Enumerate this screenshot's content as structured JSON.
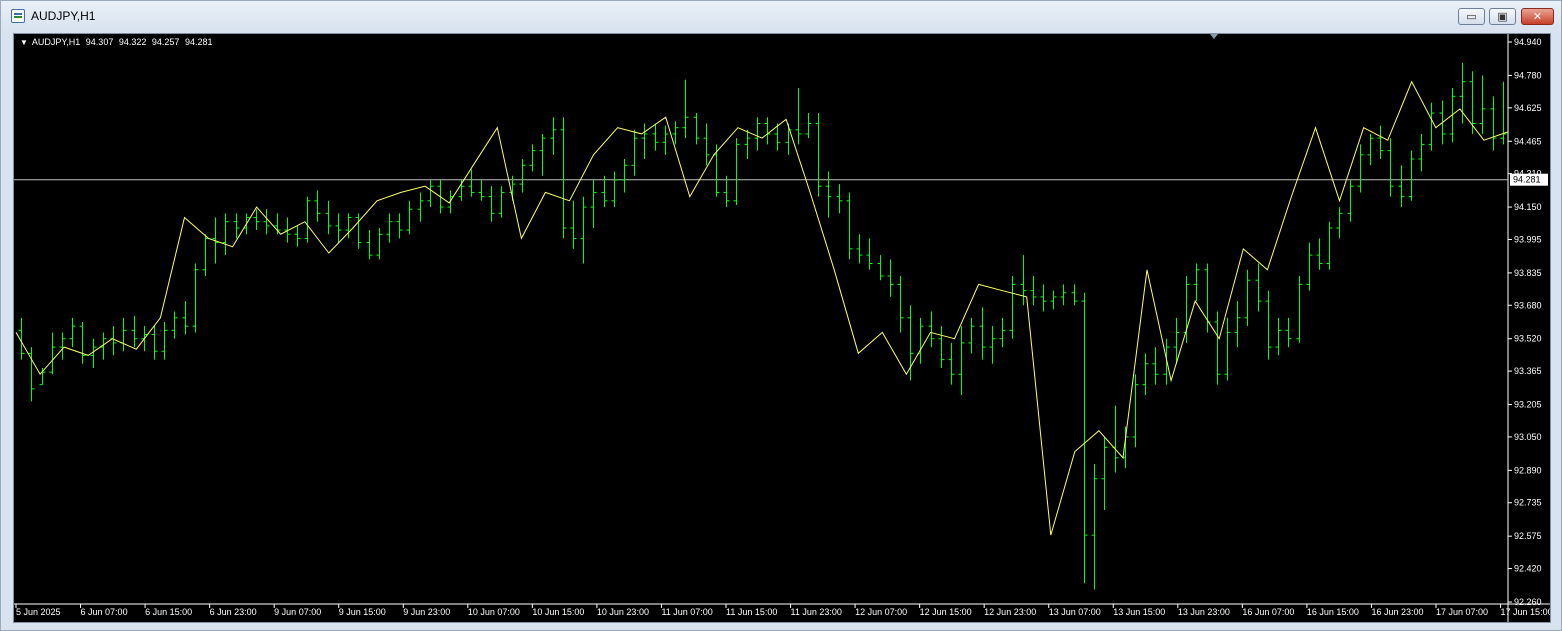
{
  "window": {
    "title": "AUDJPY,H1"
  },
  "buttons": {
    "minimize": "▭",
    "maximize": "▣",
    "close": "✕"
  },
  "header": {
    "symbol": "AUDJPY,H1",
    "open": "94.307",
    "high": "94.322",
    "low": "94.257",
    "close": "94.281"
  },
  "colors": {
    "background": "#000000",
    "bars": "#00ff00",
    "zigzag": "#ffff66",
    "price_line": "#c0c0c0",
    "axis_text": "#ffffff"
  },
  "chart_data": {
    "type": "ohlc",
    "symbol": "AUDJPY",
    "timeframe": "H1",
    "current_price": 94.281,
    "ylim": [
      92.26,
      94.94
    ],
    "yticks": [
      "94.940",
      "94.780",
      "94.625",
      "94.465",
      "94.310",
      "94.150",
      "93.995",
      "93.835",
      "93.680",
      "93.520",
      "93.365",
      "93.205",
      "93.050",
      "92.890",
      "92.735",
      "92.575",
      "92.420",
      "92.260"
    ],
    "current_price_label": "94.281",
    "xticks": [
      "5 Jun 2025",
      "6 Jun 07:00",
      "6 Jun 15:00",
      "6 Jun 23:00",
      "9 Jun 07:00",
      "9 Jun 15:00",
      "9 Jun 23:00",
      "10 Jun 07:00",
      "10 Jun 15:00",
      "10 Jun 23:00",
      "11 Jun 07:00",
      "11 Jun 15:00",
      "11 Jun 23:00",
      "12 Jun 07:00",
      "12 Jun 15:00",
      "12 Jun 23:00",
      "13 Jun 07:00",
      "13 Jun 15:00",
      "13 Jun 23:00",
      "16 Jun 07:00",
      "16 Jun 15:00",
      "16 Jun 23:00",
      "17 Jun 07:00",
      "17 Jun 15:00"
    ],
    "zigzag": [
      93.55,
      93.35,
      93.48,
      93.44,
      93.52,
      93.47,
      93.62,
      94.1,
      94.0,
      93.96,
      94.15,
      94.02,
      94.08,
      93.93,
      94.05,
      94.18,
      94.22,
      94.25,
      94.17,
      94.35,
      94.53,
      94.0,
      94.22,
      94.18,
      94.4,
      94.53,
      94.5,
      94.58,
      94.2,
      94.4,
      94.53,
      94.48,
      94.57,
      94.22,
      93.85,
      93.45,
      93.55,
      93.35,
      93.55,
      93.52,
      93.78,
      93.75,
      93.72,
      92.58,
      92.98,
      93.08,
      92.95,
      93.85,
      93.32,
      93.7,
      93.52,
      93.95,
      93.85,
      94.2,
      94.53,
      94.18,
      94.53,
      94.47,
      94.75,
      94.53,
      94.62,
      94.47,
      94.51
    ],
    "bars": [
      [
        93.56,
        93.62,
        93.42,
        93.45
      ],
      [
        93.45,
        93.48,
        93.22,
        93.28
      ],
      [
        93.3,
        93.38,
        93.3,
        93.36
      ],
      [
        93.36,
        93.55,
        93.35,
        93.48
      ],
      [
        93.48,
        93.55,
        93.42,
        93.52
      ],
      [
        93.52,
        93.62,
        93.48,
        93.58
      ],
      [
        93.58,
        93.6,
        93.4,
        93.44
      ],
      [
        93.44,
        93.52,
        93.38,
        93.48
      ],
      [
        93.48,
        93.55,
        93.42,
        93.52
      ],
      [
        93.52,
        93.58,
        93.44,
        93.5
      ],
      [
        93.5,
        93.62,
        93.46,
        93.56
      ],
      [
        93.56,
        93.63,
        93.48,
        93.52
      ],
      [
        93.52,
        93.58,
        93.46,
        93.54
      ],
      [
        93.54,
        93.58,
        93.42,
        93.46
      ],
      [
        93.46,
        93.6,
        93.42,
        93.56
      ],
      [
        93.56,
        93.65,
        93.52,
        93.62
      ],
      [
        93.62,
        93.7,
        93.54,
        93.58
      ],
      [
        93.58,
        93.88,
        93.55,
        93.85
      ],
      [
        93.85,
        94.02,
        93.82,
        94.0
      ],
      [
        94.0,
        94.1,
        93.88,
        93.98
      ],
      [
        93.98,
        94.12,
        93.92,
        94.08
      ],
      [
        94.08,
        94.12,
        94.0,
        94.05
      ],
      [
        94.05,
        94.12,
        94.02,
        94.1
      ],
      [
        94.1,
        94.14,
        94.04,
        94.08
      ],
      [
        94.08,
        94.14,
        94.02,
        94.06
      ],
      [
        94.06,
        94.12,
        94.02,
        94.04
      ],
      [
        94.04,
        94.1,
        93.98,
        94.02
      ],
      [
        94.02,
        94.06,
        93.96,
        94.0
      ],
      [
        94.0,
        94.2,
        93.98,
        94.18
      ],
      [
        94.18,
        94.23,
        94.08,
        94.12
      ],
      [
        94.12,
        94.18,
        94.02,
        94.06
      ],
      [
        94.06,
        94.12,
        93.98,
        94.04
      ],
      [
        94.04,
        94.12,
        94.0,
        94.1
      ],
      [
        94.1,
        94.12,
        93.95,
        93.98
      ],
      [
        93.98,
        94.04,
        93.9,
        93.92
      ],
      [
        93.92,
        94.05,
        93.9,
        94.02
      ],
      [
        94.02,
        94.12,
        93.98,
        94.08
      ],
      [
        94.08,
        94.12,
        94.0,
        94.04
      ],
      [
        94.04,
        94.18,
        94.02,
        94.14
      ],
      [
        94.14,
        94.22,
        94.08,
        94.18
      ],
      [
        94.18,
        94.28,
        94.15,
        94.25
      ],
      [
        94.25,
        94.28,
        94.12,
        94.15
      ],
      [
        94.15,
        94.23,
        94.12,
        94.2
      ],
      [
        94.2,
        94.28,
        94.18,
        94.25
      ],
      [
        94.25,
        94.33,
        94.2,
        94.22
      ],
      [
        94.22,
        94.28,
        94.18,
        94.2
      ],
      [
        94.2,
        94.25,
        94.08,
        94.12
      ],
      [
        94.12,
        94.25,
        94.1,
        94.22
      ],
      [
        94.22,
        94.3,
        94.18,
        94.26
      ],
      [
        94.26,
        94.38,
        94.22,
        94.35
      ],
      [
        94.35,
        94.45,
        94.32,
        94.42
      ],
      [
        94.42,
        94.5,
        94.3,
        94.48
      ],
      [
        94.48,
        94.58,
        94.4,
        94.52
      ],
      [
        94.52,
        94.58,
        94.0,
        94.05
      ],
      [
        94.05,
        94.18,
        93.95,
        94.0
      ],
      [
        94.0,
        94.2,
        93.88,
        94.15
      ],
      [
        94.15,
        94.28,
        94.05,
        94.22
      ],
      [
        94.22,
        94.3,
        94.15,
        94.18
      ],
      [
        94.18,
        94.32,
        94.15,
        94.28
      ],
      [
        94.28,
        94.38,
        94.22,
        94.35
      ],
      [
        94.35,
        94.52,
        94.3,
        94.48
      ],
      [
        94.48,
        94.55,
        94.38,
        94.5
      ],
      [
        94.5,
        94.55,
        94.42,
        94.46
      ],
      [
        94.46,
        94.54,
        94.4,
        94.5
      ],
      [
        94.5,
        94.56,
        94.45,
        94.53
      ],
      [
        94.53,
        94.76,
        94.48,
        94.58
      ],
      [
        94.58,
        94.6,
        94.45,
        94.48
      ],
      [
        94.48,
        94.55,
        94.35,
        94.4
      ],
      [
        94.4,
        94.45,
        94.2,
        94.22
      ],
      [
        94.22,
        94.3,
        94.15,
        94.18
      ],
      [
        94.18,
        94.48,
        94.16,
        94.45
      ],
      [
        94.45,
        94.52,
        94.38,
        94.48
      ],
      [
        94.48,
        94.58,
        94.42,
        94.55
      ],
      [
        94.55,
        94.58,
        94.45,
        94.5
      ],
      [
        94.5,
        94.55,
        94.42,
        94.46
      ],
      [
        94.46,
        94.55,
        94.4,
        94.52
      ],
      [
        94.52,
        94.72,
        94.45,
        94.5
      ],
      [
        94.5,
        94.6,
        94.48,
        94.55
      ],
      [
        94.55,
        94.6,
        94.2,
        94.25
      ],
      [
        94.25,
        94.32,
        94.1,
        94.2
      ],
      [
        94.2,
        94.26,
        94.12,
        94.18
      ],
      [
        94.18,
        94.22,
        93.9,
        93.95
      ],
      [
        93.95,
        94.02,
        93.88,
        93.92
      ],
      [
        93.92,
        94.0,
        93.85,
        93.88
      ],
      [
        93.88,
        93.92,
        93.8,
        93.82
      ],
      [
        93.82,
        93.9,
        93.72,
        93.78
      ],
      [
        93.78,
        93.82,
        93.55,
        93.62
      ],
      [
        93.62,
        93.68,
        93.32,
        93.45
      ],
      [
        93.45,
        93.62,
        93.4,
        93.58
      ],
      [
        93.58,
        93.65,
        93.48,
        93.52
      ],
      [
        93.52,
        93.58,
        93.38,
        93.42
      ],
      [
        93.42,
        93.5,
        93.3,
        93.35
      ],
      [
        93.35,
        93.58,
        93.25,
        93.5
      ],
      [
        93.5,
        93.62,
        93.45,
        93.58
      ],
      [
        93.58,
        93.67,
        93.42,
        93.48
      ],
      [
        93.48,
        93.58,
        93.4,
        93.52
      ],
      [
        93.52,
        93.62,
        93.48,
        93.56
      ],
      [
        93.56,
        93.82,
        93.52,
        93.78
      ],
      [
        93.78,
        93.92,
        93.68,
        93.75
      ],
      [
        93.75,
        93.82,
        93.68,
        93.72
      ],
      [
        93.72,
        93.78,
        93.65,
        93.7
      ],
      [
        93.7,
        93.75,
        93.66,
        93.72
      ],
      [
        93.72,
        93.78,
        93.68,
        93.74
      ],
      [
        93.74,
        93.78,
        93.68,
        93.7
      ],
      [
        93.7,
        93.74,
        92.35,
        92.58
      ],
      [
        92.58,
        92.92,
        92.32,
        92.85
      ],
      [
        92.85,
        93.05,
        92.7,
        93.0
      ],
      [
        93.0,
        93.2,
        92.88,
        92.95
      ],
      [
        92.95,
        93.1,
        92.9,
        93.05
      ],
      [
        93.05,
        93.35,
        93.0,
        93.3
      ],
      [
        93.3,
        93.45,
        93.25,
        93.4
      ],
      [
        93.4,
        93.48,
        93.3,
        93.35
      ],
      [
        93.35,
        93.52,
        93.3,
        93.48
      ],
      [
        93.48,
        93.62,
        93.4,
        93.55
      ],
      [
        93.55,
        93.82,
        93.5,
        93.78
      ],
      [
        93.78,
        93.88,
        93.7,
        93.85
      ],
      [
        93.85,
        93.88,
        93.55,
        93.6
      ],
      [
        93.6,
        93.65,
        93.3,
        93.35
      ],
      [
        93.35,
        93.62,
        93.32,
        93.55
      ],
      [
        93.55,
        93.7,
        93.48,
        93.62
      ],
      [
        93.62,
        93.85,
        93.58,
        93.8
      ],
      [
        93.8,
        93.88,
        93.65,
        93.7
      ],
      [
        93.7,
        93.75,
        93.42,
        93.48
      ],
      [
        93.48,
        93.62,
        93.44,
        93.56
      ],
      [
        93.56,
        93.62,
        93.48,
        93.52
      ],
      [
        93.52,
        93.82,
        93.5,
        93.78
      ],
      [
        93.78,
        93.98,
        93.75,
        93.92
      ],
      [
        93.92,
        94.0,
        93.85,
        93.88
      ],
      [
        93.88,
        94.08,
        93.85,
        94.05
      ],
      [
        94.05,
        94.15,
        94.0,
        94.12
      ],
      [
        94.12,
        94.28,
        94.08,
        94.25
      ],
      [
        94.25,
        94.45,
        94.22,
        94.4
      ],
      [
        94.4,
        94.5,
        94.35,
        94.48
      ],
      [
        94.48,
        94.54,
        94.38,
        94.42
      ],
      [
        94.42,
        94.48,
        94.2,
        94.25
      ],
      [
        94.25,
        94.35,
        94.15,
        94.2
      ],
      [
        94.2,
        94.42,
        94.18,
        94.38
      ],
      [
        94.38,
        94.5,
        94.32,
        94.45
      ],
      [
        94.45,
        94.65,
        94.42,
        94.6
      ],
      [
        94.6,
        94.66,
        94.45,
        94.5
      ],
      [
        94.5,
        94.72,
        94.46,
        94.68
      ],
      [
        94.68,
        94.84,
        94.55,
        94.75
      ],
      [
        94.75,
        94.8,
        94.5,
        94.55
      ],
      [
        94.55,
        94.78,
        94.5,
        94.62
      ],
      [
        94.62,
        94.68,
        94.42,
        94.48
      ],
      [
        94.48,
        94.75,
        94.45,
        94.5
      ]
    ]
  }
}
